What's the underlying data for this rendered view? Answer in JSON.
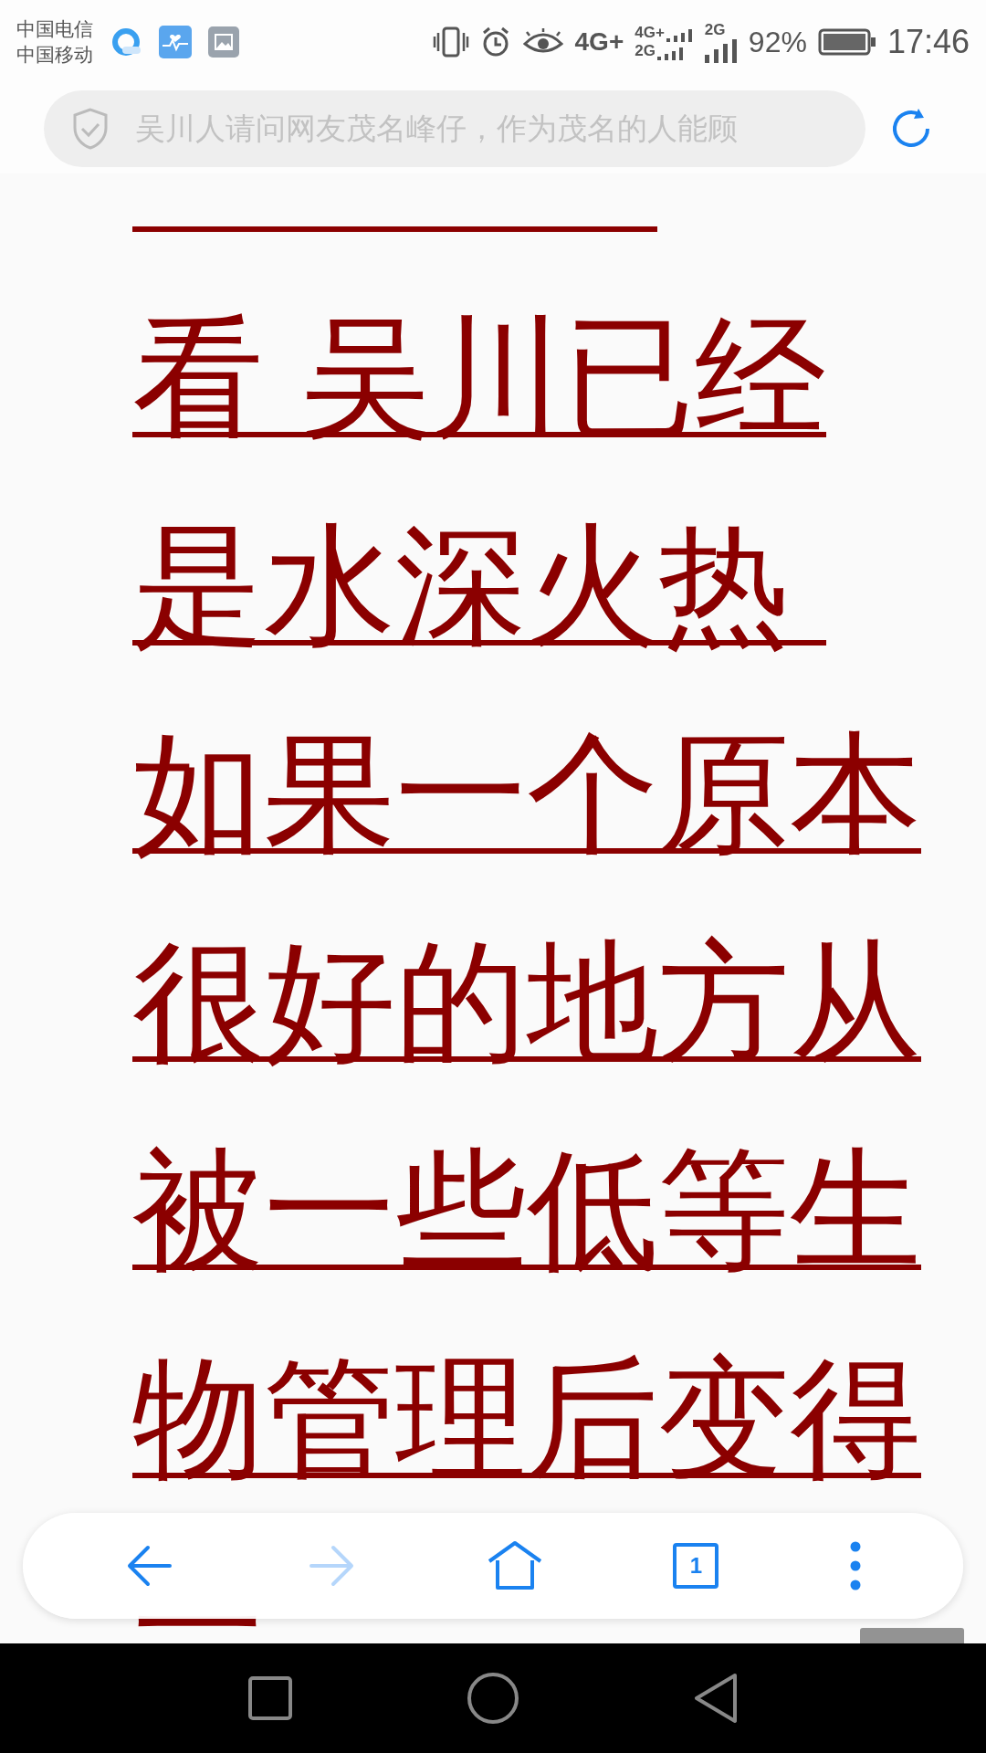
{
  "status_bar": {
    "carriers": [
      "中国电信",
      "中国移动"
    ],
    "network_labels": [
      "4G+",
      "4G+",
      "2G",
      "2G"
    ],
    "battery": "92%",
    "time": "17:46"
  },
  "address_bar": {
    "title": "吴川人请问网友茂名峰仔，作为茂名的人能顾"
  },
  "article_lines": [
    "看 吴川已经",
    "是水深火热 ",
    "如果一个原本",
    "很好的地方从",
    "被一些低等生",
    "物管理后变得",
    "一"
  ],
  "toolbar": {
    "back_disabled": false,
    "forward_disabled": true,
    "tab_count": "1"
  }
}
